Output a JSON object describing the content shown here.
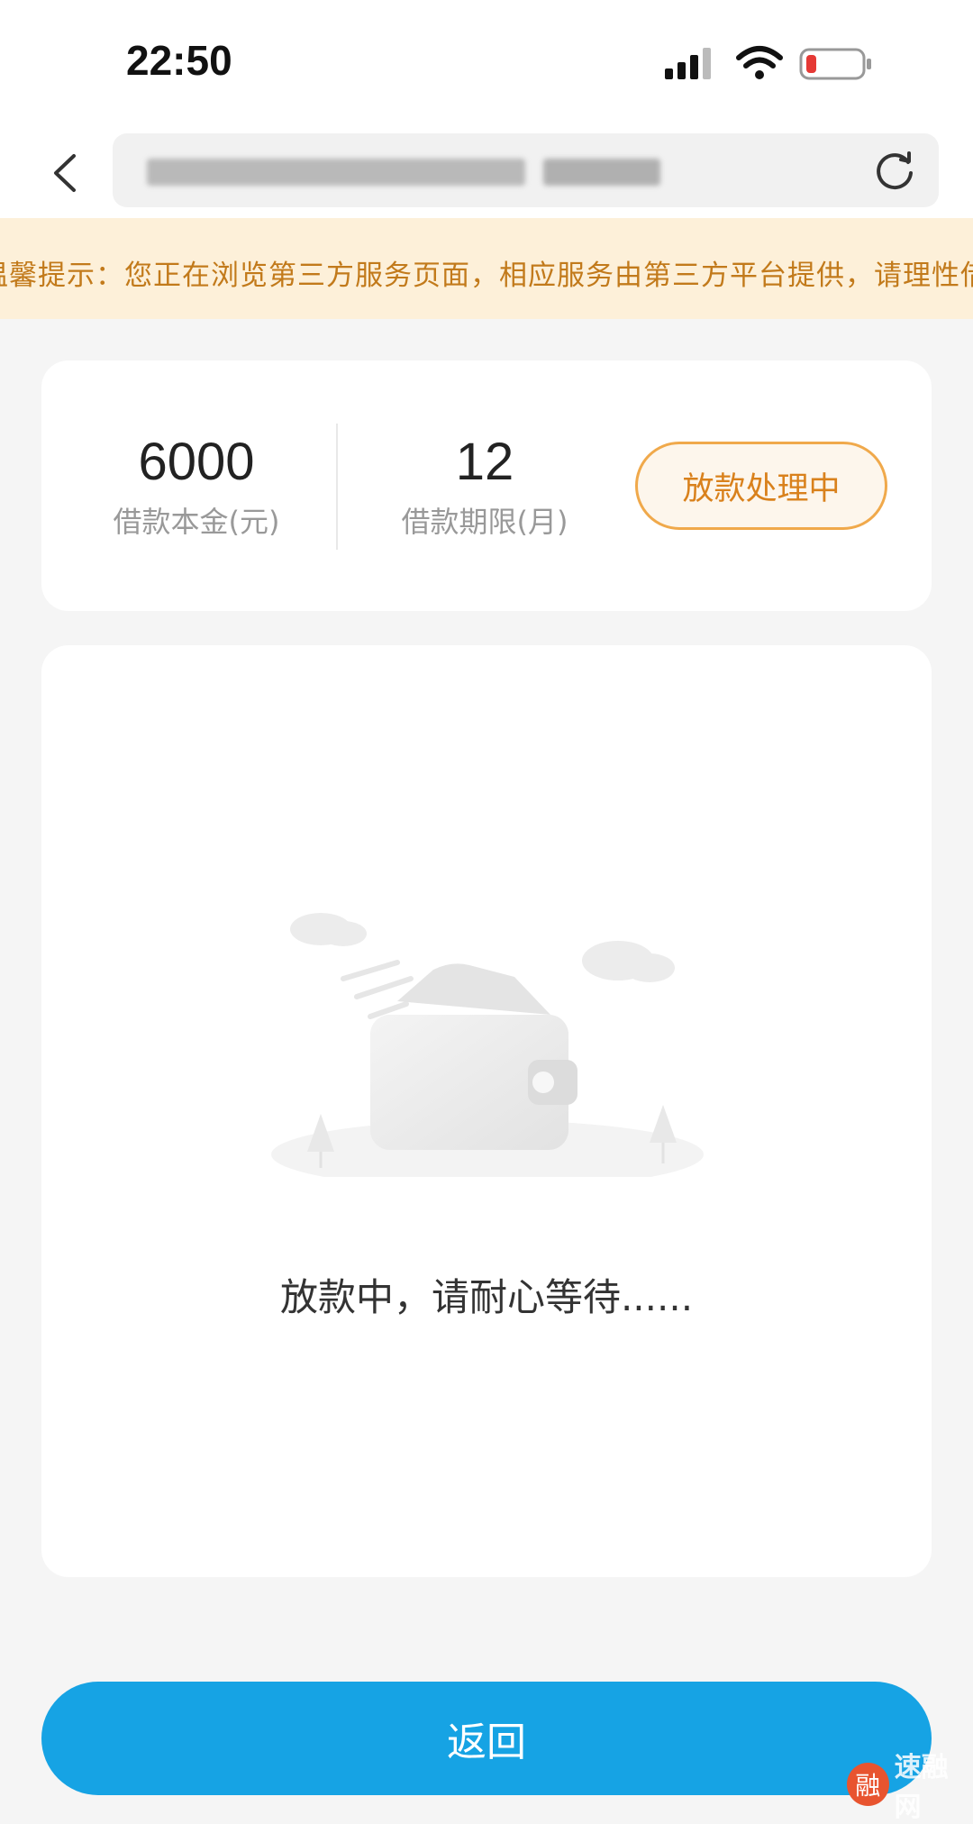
{
  "status_bar": {
    "time": "22:50",
    "icons": [
      "signal-icon",
      "wifi-icon",
      "battery-low-icon"
    ],
    "battery_color": "#e53935"
  },
  "nav": {
    "back_icon": "chevron-left-icon",
    "refresh_icon": "refresh-icon"
  },
  "notice": {
    "text": "温馨提示：您正在浏览第三方服务页面，相应服务由第三方平台提供，请理性借贷",
    "color": "#c27a1b",
    "background": "#fdf0d9"
  },
  "summary": {
    "principal_value": "6000",
    "principal_label": "借款本金(元)",
    "term_value": "12",
    "term_label": "借款期限(月)",
    "status": "放款处理中"
  },
  "main": {
    "illustration_icon": "wallet-icon",
    "message": "放款中，请耐心等待......"
  },
  "actions": {
    "return_label": "返回",
    "accent": "#16a3e4"
  },
  "watermark": {
    "logo_char": "融",
    "text": "速融网"
  }
}
